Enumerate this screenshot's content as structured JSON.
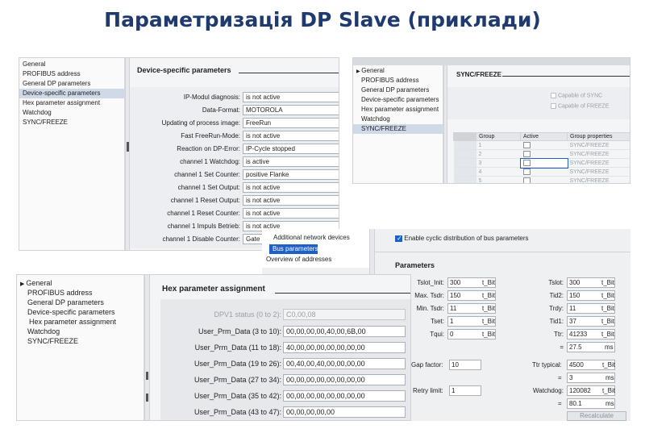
{
  "slide": {
    "title": "Параметризація DP Slave (приклади)"
  },
  "panel1": {
    "nav": [
      "General",
      "PROFIBUS address",
      "General DP parameters",
      "Device-specific parameters",
      "Hex parameter assignment",
      "Watchdog",
      "SYNC/FREEZE"
    ],
    "selected_index": 3,
    "heading": "Device-specific parameters",
    "params": [
      {
        "label": "IP-Modul diagnosis:",
        "value": "is not active"
      },
      {
        "label": "Data-Format:",
        "value": "MOTOROLA"
      },
      {
        "label": "Updating of process image:",
        "value": "FreeRun"
      },
      {
        "label": "Fast FreeRun-Mode:",
        "value": "is not active"
      },
      {
        "label": "Reaction on DP-Error:",
        "value": "IP-Cycle stopped"
      },
      {
        "label": "channel 1 Watchdog:",
        "value": "is active"
      },
      {
        "label": "channel 1 Set Counter:",
        "value": "positive Flanke"
      },
      {
        "label": "channel 1 Set Output:",
        "value": "is not active"
      },
      {
        "label": "channel 1 Reset Output:",
        "value": "is not active"
      },
      {
        "label": "channel 1 Reset Counter:",
        "value": "is not active"
      },
      {
        "label": "channel 1 Impuls Betrieb:",
        "value": "is not active"
      },
      {
        "label": "channel 1 Disable Counter:",
        "value": "Gate 1"
      }
    ]
  },
  "panel2": {
    "nav": [
      "General",
      "PROFIBUS address",
      "General DP parameters",
      "Device-specific parameters",
      "Hex parameter assignment",
      "Watchdog",
      "SYNC/FREEZE"
    ],
    "selected_index": 6,
    "heading": "SYNC/FREEZE",
    "capable_sync": "Capable of SYNC",
    "capable_freeze": "Capable of FREEZE",
    "columns": [
      "Group",
      "Active",
      "Group properties"
    ],
    "rows": [
      {
        "group": "1",
        "props": "SYNC/FREEZE"
      },
      {
        "group": "2",
        "props": "SYNC/FREEZE"
      },
      {
        "group": "3",
        "props": "SYNC/FREEZE"
      },
      {
        "group": "4",
        "props": "SYNC/FREEZE"
      },
      {
        "group": "5",
        "props": "SYNC/FREEZE"
      }
    ]
  },
  "panel3": {
    "nav": [
      "General",
      "PROFIBUS address",
      "General DP parameters",
      "Device-specific parameters",
      "Hex parameter assignment",
      "Watchdog",
      "SYNC/FREEZE"
    ],
    "selected_index": 4,
    "heading": "Hex parameter assignment",
    "dpv1_label": "DPV1 status (0 to 2):",
    "dpv1_value": "C0,00,08",
    "rows": [
      {
        "label": "User_Prm_Data (3 to 10):",
        "value": "00,00,00,00,40,00,6B,00"
      },
      {
        "label": "User_Prm_Data (11 to 18):",
        "value": "40,00,00,00,00,00,00,00"
      },
      {
        "label": "User_Prm_Data (19 to 26):",
        "value": "00,40,00,40,00,00,00,00"
      },
      {
        "label": "User_Prm_Data (27 to 34):",
        "value": "00,00,00,00,00,00,00,00"
      },
      {
        "label": "User_Prm_Data (35 to 42):",
        "value": "00,00,00,00,00,00,00,00"
      },
      {
        "label": "User_Prm_Data (43 to 47):",
        "value": "00,00,00,00,00"
      }
    ]
  },
  "panel4": {
    "nav": [
      "Additional network devices",
      "Bus parameters",
      "Overview of addresses"
    ],
    "nav_selected": 1,
    "enable_label": "Enable cyclic distribution of bus parameters",
    "heading": "Parameters",
    "left": [
      {
        "label": "Tslot_Init:",
        "value": "300",
        "unit": "t_Bit"
      },
      {
        "label": "Max. Tsdr:",
        "value": "150",
        "unit": "t_Bit"
      },
      {
        "label": "Min. Tsdr:",
        "value": "11",
        "unit": "t_Bit"
      },
      {
        "label": "Tset:",
        "value": "1",
        "unit": "t_Bit"
      },
      {
        "label": "Tqui:",
        "value": "0",
        "unit": "t_Bit"
      }
    ],
    "right": [
      {
        "label": "Tslot:",
        "value": "300",
        "unit": "t_Bit"
      },
      {
        "label": "Tid2:",
        "value": "150",
        "unit": "t_Bit"
      },
      {
        "label": "Trdy:",
        "value": "11",
        "unit": "t_Bit"
      },
      {
        "label": "Tid1:",
        "value": "37",
        "unit": "t_Bit"
      },
      {
        "label": "Ttr:",
        "value": "41233",
        "unit": "t_Bit"
      },
      {
        "label": "=",
        "value": "27.5",
        "unit": "ms"
      }
    ],
    "gap_label": "Gap factor:",
    "gap_value": "10",
    "ttr_typical_label": "Ttr typical:",
    "ttr_typical_value": "4500",
    "ttr_typical_unit": "t_Bit",
    "ttr_typical_eq": "=",
    "ttr_typical_ms": "3",
    "ttr_typical_ms_unit": "ms",
    "retry_label": "Retry limit:",
    "retry_value": "1",
    "watchdog_label": "Watchdog:",
    "watchdog_value": "120082",
    "watchdog_unit": "t_Bit",
    "watchdog_eq": "=",
    "watchdog_ms": "80.1",
    "watchdog_ms_unit": "ms",
    "recalc_label": "Recalculate"
  }
}
